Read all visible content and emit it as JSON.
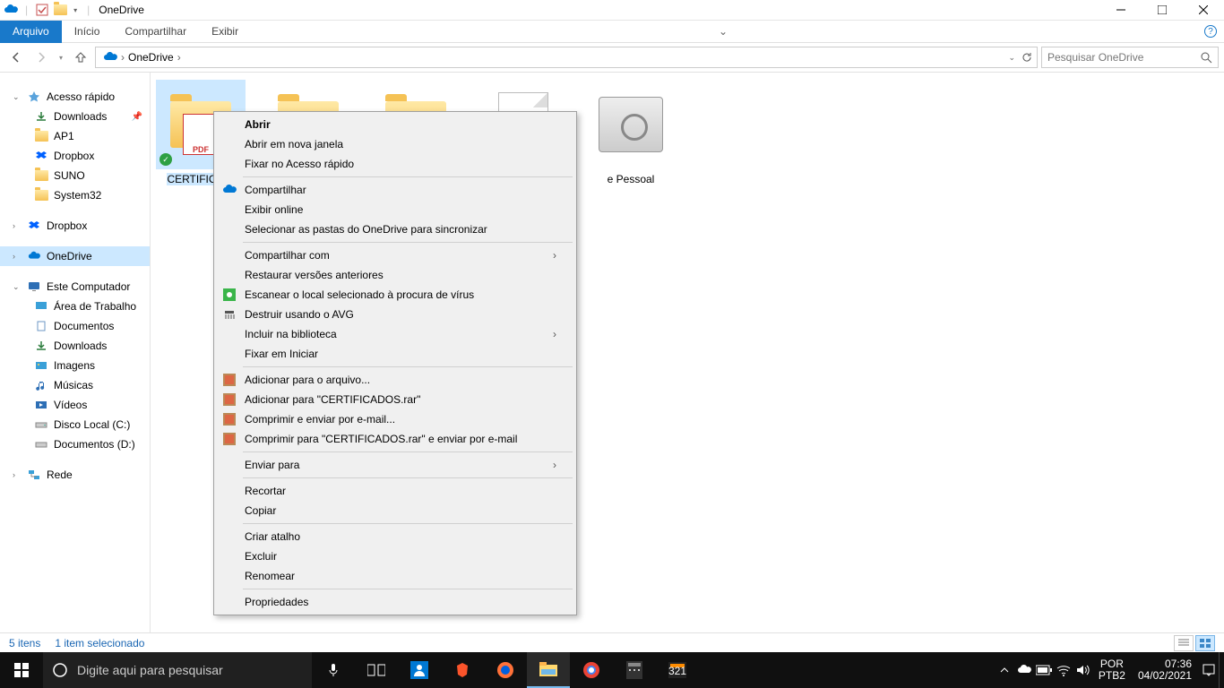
{
  "titlebar": {
    "title": "OneDrive"
  },
  "ribbon": {
    "file": "Arquivo",
    "tabs": [
      "Início",
      "Compartilhar",
      "Exibir"
    ]
  },
  "address": {
    "location": "OneDrive",
    "search_placeholder": "Pesquisar OneDrive"
  },
  "sidebar": {
    "quick_access": "Acesso rápido",
    "quick_items": [
      {
        "label": "Downloads",
        "icon": "download"
      },
      {
        "label": "AP1",
        "icon": "folder"
      },
      {
        "label": "Dropbox",
        "icon": "dropbox"
      },
      {
        "label": "SUNO",
        "icon": "folder"
      },
      {
        "label": "System32",
        "icon": "folder"
      }
    ],
    "dropbox": "Dropbox",
    "onedrive": "OneDrive",
    "thispc": "Este Computador",
    "pc_items": [
      {
        "label": "Área de Trabalho",
        "icon": "desktop"
      },
      {
        "label": "Documentos",
        "icon": "documents"
      },
      {
        "label": "Downloads",
        "icon": "download"
      },
      {
        "label": "Imagens",
        "icon": "pictures"
      },
      {
        "label": "Músicas",
        "icon": "music"
      },
      {
        "label": "Vídeos",
        "icon": "videos"
      },
      {
        "label": "Disco Local (C:)",
        "icon": "drive"
      },
      {
        "label": "Documentos (D:)",
        "icon": "drive"
      }
    ],
    "network": "Rede"
  },
  "files": [
    {
      "label": "CERTIFICA…",
      "kind": "pdf-folder",
      "selected": true
    },
    {
      "label": "",
      "kind": "folder"
    },
    {
      "label": "",
      "kind": "folder"
    },
    {
      "label": "",
      "kind": "doc"
    },
    {
      "label": "e Pessoal",
      "kind": "vault"
    }
  ],
  "context_menu": {
    "open": "Abrir",
    "open_new_window": "Abrir em nova janela",
    "pin_quick": "Fixar no Acesso rápido",
    "share": "Compartilhar",
    "view_online": "Exibir online",
    "choose_folders": "Selecionar as pastas do OneDrive para sincronizar",
    "share_with": "Compartilhar com",
    "restore_versions": "Restaurar versões anteriores",
    "scan_virus": "Escanear o local selecionado à procura de vírus",
    "shred_avg": "Destruir usando o AVG",
    "include_library": "Incluir na biblioteca",
    "pin_start": "Fixar em Iniciar",
    "add_archive": "Adicionar para o arquivo...",
    "add_rar": "Adicionar para \"CERTIFICADOS.rar\"",
    "compress_email": "Comprimir e enviar por e-mail...",
    "compress_rar_email": "Comprimir para \"CERTIFICADOS.rar\" e enviar por e-mail",
    "send_to": "Enviar para",
    "cut": "Recortar",
    "copy": "Copiar",
    "create_shortcut": "Criar atalho",
    "delete": "Excluir",
    "rename": "Renomear",
    "properties": "Propriedades"
  },
  "statusbar": {
    "count": "5 itens",
    "selection": "1 item selecionado"
  },
  "taskbar": {
    "search_placeholder": "Digite aqui para pesquisar",
    "lang1": "POR",
    "lang2": "PTB2",
    "time": "07:36",
    "date": "04/02/2021"
  }
}
